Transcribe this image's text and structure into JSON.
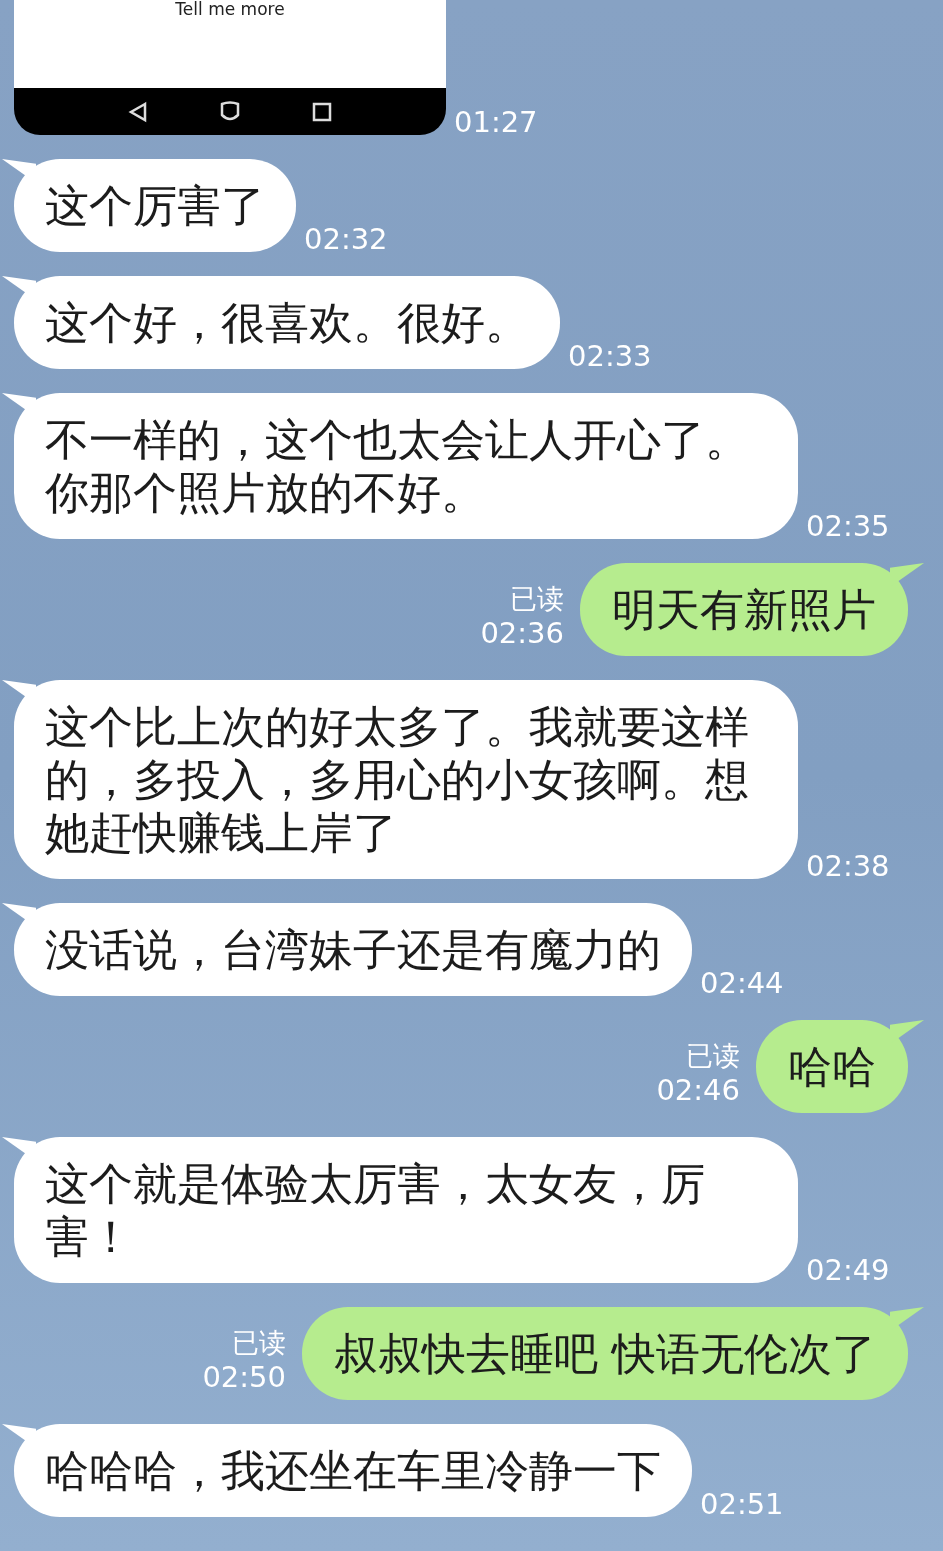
{
  "image_message": {
    "caption": "Tell me more",
    "time": "01:27"
  },
  "messages": [
    {
      "kind": "in",
      "text": "这个厉害了",
      "time": "02:32"
    },
    {
      "kind": "in",
      "text": "这个好，很喜欢。很好。",
      "time": "02:33"
    },
    {
      "kind": "in",
      "text": "不一样的，这个也太会让人开心了。你那个照片放的不好。",
      "time": "02:35"
    },
    {
      "kind": "out",
      "text": "明天有新照片",
      "read": "已读",
      "time": "02:36"
    },
    {
      "kind": "in",
      "text": "这个比上次的好太多了。我就要这样的，多投入，多用心的小女孩啊。想她赶快赚钱上岸了",
      "time": "02:38"
    },
    {
      "kind": "in",
      "text": "没话说，台湾妹子还是有魔力的",
      "time": "02:44"
    },
    {
      "kind": "out",
      "text": "哈哈",
      "read": "已读",
      "time": "02:46"
    },
    {
      "kind": "in",
      "text": "这个就是体验太厉害，太女友，厉害！",
      "time": "02:49"
    },
    {
      "kind": "out",
      "text": "叔叔快去睡吧 快语无伦次了",
      "read": "已读",
      "time": "02:50"
    },
    {
      "kind": "in",
      "text": "哈哈哈，我还坐在车里冷静一下",
      "time": "02:51"
    }
  ]
}
